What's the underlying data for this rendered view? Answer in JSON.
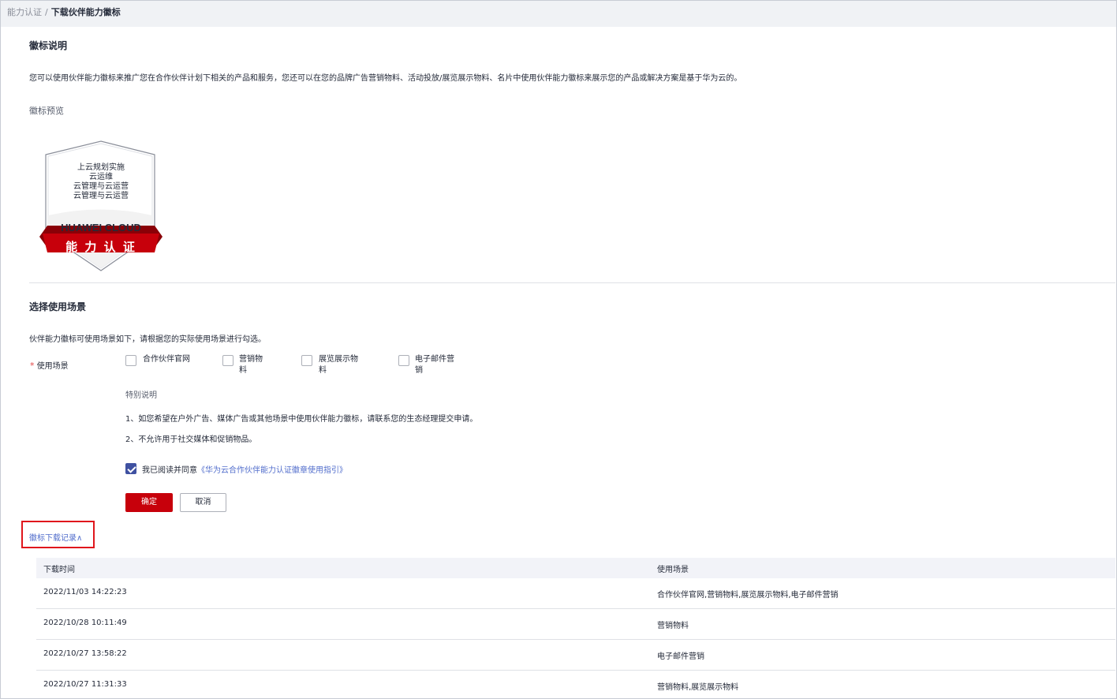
{
  "breadcrumb": {
    "parent": "能力认证",
    "separator": "/",
    "current": "下载伙伴能力徽标"
  },
  "badge_section": {
    "title": "徽标说明",
    "description": "您可以使用伙伴能力徽标来推广您在合作伙伴计划下相关的产品和服务，您还可以在您的品牌广告营销物料、活动投放/展览展示物料、名片中使用伙伴能力徽标来展示您的产品或解决方案是基于华为云的。",
    "preview_label": "徽标预览",
    "badge": {
      "lines": [
        "上云规划实施",
        "云运维",
        "云管理与云运营",
        "云管理与云运营"
      ],
      "brand": "HUAWEI CLOUD",
      "ribbon": "能 力 认 证",
      "ribbon_color": "#c7000b"
    }
  },
  "usage_section": {
    "title": "选择使用场景",
    "hint": "伙伴能力徽标可使用场景如下，请根据您的实际使用场景进行勾选。",
    "field_label": "使用场景",
    "required_mark": "*",
    "options": [
      {
        "label": "合作伙伴官网",
        "checked": false
      },
      {
        "label": "营销物料",
        "checked": false
      },
      {
        "label": "展览展示物料",
        "checked": false
      },
      {
        "label": "电子邮件营销",
        "checked": false
      }
    ],
    "notes_title": "特别说明",
    "notes": [
      "1、如您希望在户外广告、媒体广告或其他场景中使用伙伴能力徽标，请联系您的生态经理提交申请。",
      "2、不允许用于社交媒体和促销物品。"
    ],
    "agreement": {
      "checked": true,
      "prefix": "我已阅读并同意",
      "link": "《华为云合作伙伴能力认证徽章使用指引》"
    },
    "confirm_label": "确定",
    "cancel_label": "取消"
  },
  "records": {
    "toggle_label": "徽标下载记录∧",
    "columns": [
      "下载时间",
      "使用场景"
    ],
    "rows": [
      {
        "time": "2022/11/03 14:22:23",
        "scenes": "合作伙伴官网,营销物料,展览展示物料,电子邮件营销"
      },
      {
        "time": "2022/10/28 10:11:49",
        "scenes": "营销物料"
      },
      {
        "time": "2022/10/27 13:58:22",
        "scenes": "电子邮件营销"
      },
      {
        "time": "2022/10/27 11:31:33",
        "scenes": "营销物料,展览展示物料"
      }
    ]
  },
  "colors": {
    "primary": "#c7000b",
    "link": "#526ecc",
    "checkbox_checked": "#3f51a1"
  }
}
